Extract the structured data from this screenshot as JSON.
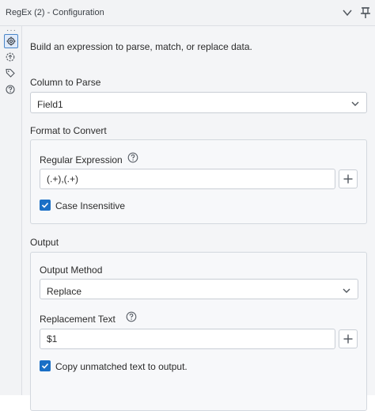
{
  "window": {
    "title": "RegEx (2) - Configuration",
    "icons": {
      "collapse": "chevron-down-icon",
      "pin": "pin-icon"
    }
  },
  "rail": {
    "items": [
      {
        "name": "configuration",
        "icon": "gear-icon",
        "active": true
      },
      {
        "name": "annotation",
        "icon": "annotation-icon",
        "active": false
      },
      {
        "name": "tags",
        "icon": "tag-icon",
        "active": false
      },
      {
        "name": "help",
        "icon": "help-icon",
        "active": false
      }
    ]
  },
  "intro": "Build an expression to parse, match, or replace data.",
  "column_to_parse": {
    "label": "Column to Parse",
    "value": "Field1"
  },
  "format_to_convert": {
    "label": "Format to Convert",
    "regex_label": "Regular Expression",
    "regex_value": "(.+),(.+)",
    "case_insensitive": {
      "label": "Case Insensitive",
      "checked": true
    }
  },
  "output": {
    "label": "Output",
    "method_label": "Output Method",
    "method_value": "Replace",
    "replacement_label": "Replacement Text",
    "replacement_value": "$1",
    "copy_unmatched": {
      "label": "Copy unmatched text to output.",
      "checked": true
    }
  },
  "colors": {
    "accent": "#1a6fc6",
    "panel_bg": "#f4f5f7",
    "border": "#c9ced5"
  }
}
